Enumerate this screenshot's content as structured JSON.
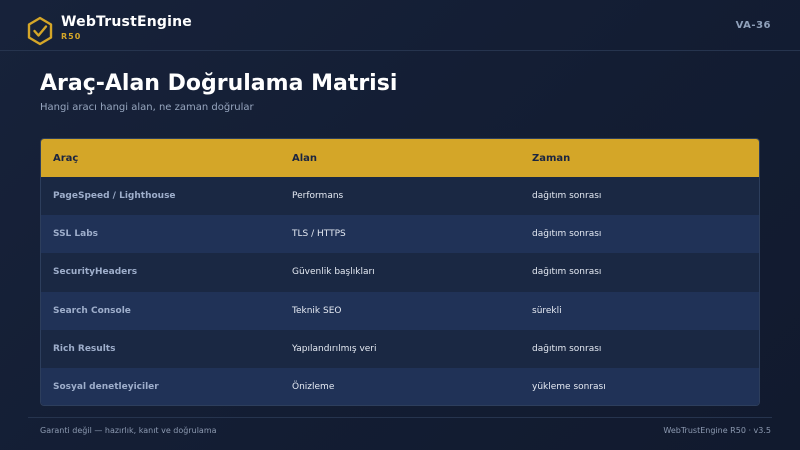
{
  "brand": {
    "name": "WebTrustEngine",
    "sub": "R50",
    "page_code": "VA-36",
    "logo_icon": "shield-check-icon",
    "accent_color": "#d4a628"
  },
  "page": {
    "title": "Araç-Alan Doğrulama Matrisi",
    "subtitle": "Hangi aracı hangi alan, ne zaman doğrular"
  },
  "table": {
    "headers": [
      "Araç",
      "Alan",
      "Zaman"
    ],
    "rows": [
      [
        "PageSpeed / Lighthouse",
        "Performans",
        "dağıtım sonrası"
      ],
      [
        "SSL Labs",
        "TLS / HTTPS",
        "dağıtım sonrası"
      ],
      [
        "SecurityHeaders",
        "Güvenlik başlıkları",
        "dağıtım sonrası"
      ],
      [
        "Search Console",
        "Teknik SEO",
        "sürekli"
      ],
      [
        "Rich Results",
        "Yapılandırılmış veri",
        "dağıtım sonrası"
      ],
      [
        "Sosyal denetleyiciler",
        "Önizleme",
        "yükleme sonrası"
      ]
    ]
  },
  "footer": {
    "left": "Garanti değil — hazırlık, kanıt ve doğrulama",
    "right": "WebTrustEngine R50 · v3.5"
  }
}
